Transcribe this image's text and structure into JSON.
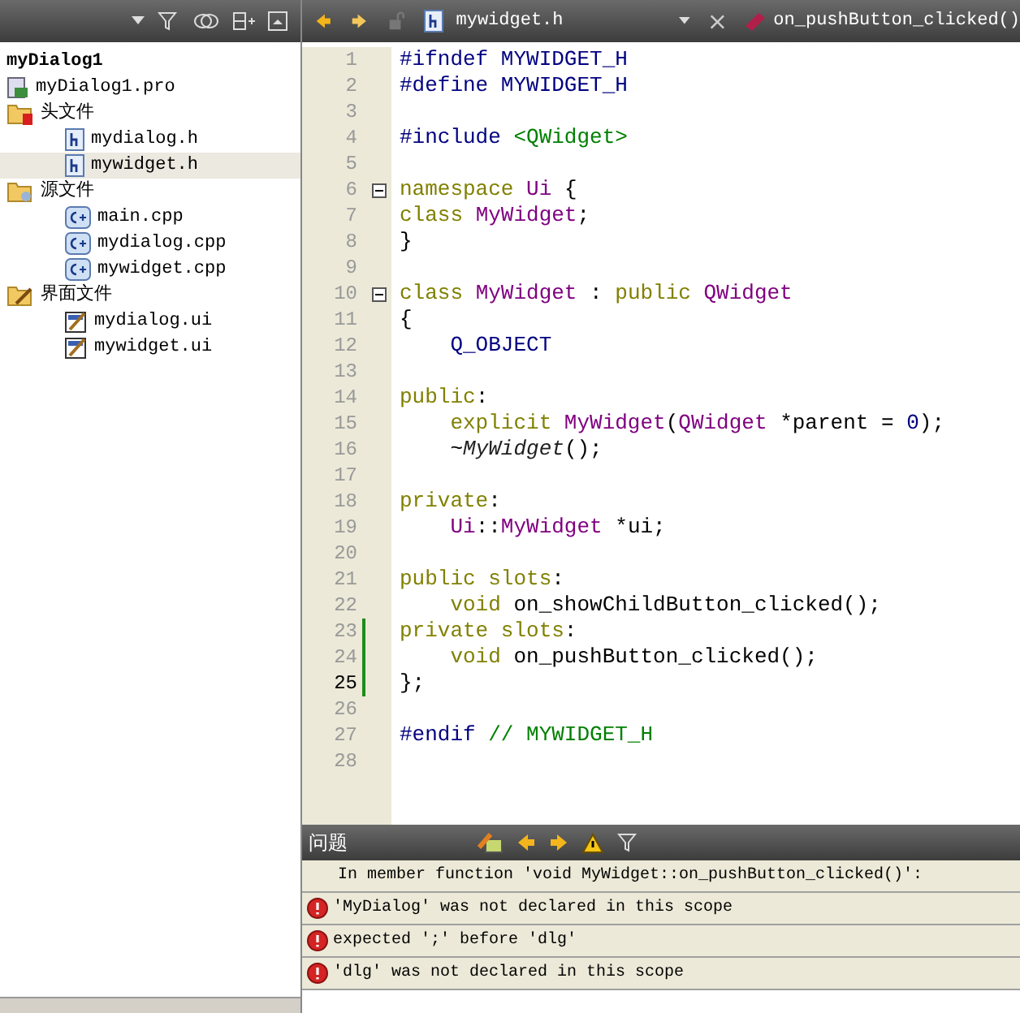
{
  "project_tree": {
    "root": "myDialog1",
    "items": [
      {
        "label": "myDialog1.pro",
        "kind": "pro",
        "selected": false
      },
      {
        "label": "头文件",
        "kind": "headers-folder",
        "selected": false,
        "children": [
          {
            "label": "mydialog.h",
            "kind": "header",
            "selected": false
          },
          {
            "label": "mywidget.h",
            "kind": "header",
            "selected": true
          }
        ]
      },
      {
        "label": "源文件",
        "kind": "sources-folder",
        "selected": false,
        "children": [
          {
            "label": "main.cpp",
            "kind": "source",
            "selected": false
          },
          {
            "label": "mydialog.cpp",
            "kind": "source",
            "selected": false
          },
          {
            "label": "mywidget.cpp",
            "kind": "source",
            "selected": false
          }
        ]
      },
      {
        "label": "界面文件",
        "kind": "forms-folder",
        "selected": false,
        "children": [
          {
            "label": "mydialog.ui",
            "kind": "form",
            "selected": false
          },
          {
            "label": "mywidget.ui",
            "kind": "form",
            "selected": false
          }
        ]
      }
    ]
  },
  "editor": {
    "file": "mywidget.h",
    "symbol": "on_pushButton_clicked()",
    "lines": [
      {
        "number": "1",
        "tokens": [
          {
            "t": "#ifndef MYWIDGET_H",
            "kind": "pre"
          }
        ]
      },
      {
        "number": "2",
        "tokens": [
          {
            "t": "#define MYWIDGET_H",
            "kind": "pre"
          }
        ]
      },
      {
        "number": "3"
      },
      {
        "number": "4",
        "tokens": [
          {
            "t": "#include ",
            "kind": "pre"
          },
          {
            "t": "<QWidget>",
            "kind": "inc"
          }
        ]
      },
      {
        "number": "5"
      },
      {
        "number": "6",
        "fold": true,
        "tokens": [
          {
            "t": "namespace",
            "kind": "kw"
          },
          {
            "t": " Ui ",
            "kind": "type"
          },
          {
            "t": "{",
            "kind": "plain"
          }
        ]
      },
      {
        "number": "7",
        "tokens": [
          {
            "t": "class",
            "kind": "kw"
          },
          {
            "t": " MyWidget",
            "kind": "type"
          },
          {
            "t": ";",
            "kind": "plain"
          }
        ]
      },
      {
        "number": "8",
        "tokens": [
          {
            "t": "}",
            "kind": "plain"
          }
        ]
      },
      {
        "number": "9"
      },
      {
        "number": "10",
        "fold": true,
        "tokens": [
          {
            "t": "class",
            "kind": "kw"
          },
          {
            "t": " MyWidget",
            "kind": "type"
          },
          {
            "t": " : ",
            "kind": "plain"
          },
          {
            "t": "public",
            "kind": "kw"
          },
          {
            "t": " QWidget",
            "kind": "type"
          }
        ]
      },
      {
        "number": "11",
        "tokens": [
          {
            "t": "{",
            "kind": "plain"
          }
        ]
      },
      {
        "number": "12",
        "tokens": [
          {
            "t": "    Q_OBJECT",
            "kind": "pre"
          }
        ]
      },
      {
        "number": "13"
      },
      {
        "number": "14",
        "tokens": [
          {
            "t": "public",
            "kind": "kw"
          },
          {
            "t": ":",
            "kind": "plain"
          }
        ]
      },
      {
        "number": "15",
        "tokens": [
          {
            "t": "    explicit",
            "kind": "kw"
          },
          {
            "t": " MyWidget",
            "kind": "type"
          },
          {
            "t": "(",
            "kind": "plain"
          },
          {
            "t": "QWidget",
            "kind": "type"
          },
          {
            "t": " *parent = ",
            "kind": "plain"
          },
          {
            "t": "0",
            "kind": "pre"
          },
          {
            "t": ");",
            "kind": "plain"
          }
        ]
      },
      {
        "number": "16",
        "tokens": [
          {
            "t": "    ~",
            "kind": "plain"
          },
          {
            "t": "MyWidget",
            "kind": "decl"
          },
          {
            "t": "();",
            "kind": "plain"
          }
        ]
      },
      {
        "number": "17"
      },
      {
        "number": "18",
        "tokens": [
          {
            "t": "private",
            "kind": "kw"
          },
          {
            "t": ":",
            "kind": "plain"
          }
        ]
      },
      {
        "number": "19",
        "tokens": [
          {
            "t": "    Ui",
            "kind": "type"
          },
          {
            "t": "::",
            "kind": "plain"
          },
          {
            "t": "MyWidget",
            "kind": "type"
          },
          {
            "t": " *ui;",
            "kind": "plain"
          }
        ]
      },
      {
        "number": "20"
      },
      {
        "number": "21",
        "tokens": [
          {
            "t": "public slots",
            "kind": "kw"
          },
          {
            "t": ":",
            "kind": "plain"
          }
        ]
      },
      {
        "number": "22",
        "tokens": [
          {
            "t": "    void",
            "kind": "kw"
          },
          {
            "t": " on_showChildButton_clicked();",
            "kind": "plain"
          }
        ]
      },
      {
        "number": "23",
        "modified": true,
        "tokens": [
          {
            "t": "private slots",
            "kind": "kw"
          },
          {
            "t": ":",
            "kind": "plain"
          }
        ]
      },
      {
        "number": "24",
        "modified": true,
        "tokens": [
          {
            "t": "    void",
            "kind": "kw"
          },
          {
            "t": " on_pushButton_clicked();",
            "kind": "plain"
          }
        ]
      },
      {
        "number": "25",
        "modified": true,
        "current": true,
        "tokens": [
          {
            "t": "};",
            "kind": "plain"
          }
        ]
      },
      {
        "number": "26"
      },
      {
        "number": "27",
        "tokens": [
          {
            "t": "#endif ",
            "kind": "pre"
          },
          {
            "t": "// MYWIDGET_H",
            "kind": "cmt"
          }
        ]
      },
      {
        "number": "28"
      }
    ]
  },
  "issues": {
    "title": "问题",
    "rows": [
      {
        "kind": "context",
        "text": "In member function 'void MyWidget::on_pushButton_clicked()':"
      },
      {
        "kind": "error",
        "text": "'MyDialog' was not declared in this scope"
      },
      {
        "kind": "error",
        "text": "expected ';' before 'dlg'"
      },
      {
        "kind": "error",
        "text": "'dlg' was not declared in this scope"
      }
    ]
  }
}
